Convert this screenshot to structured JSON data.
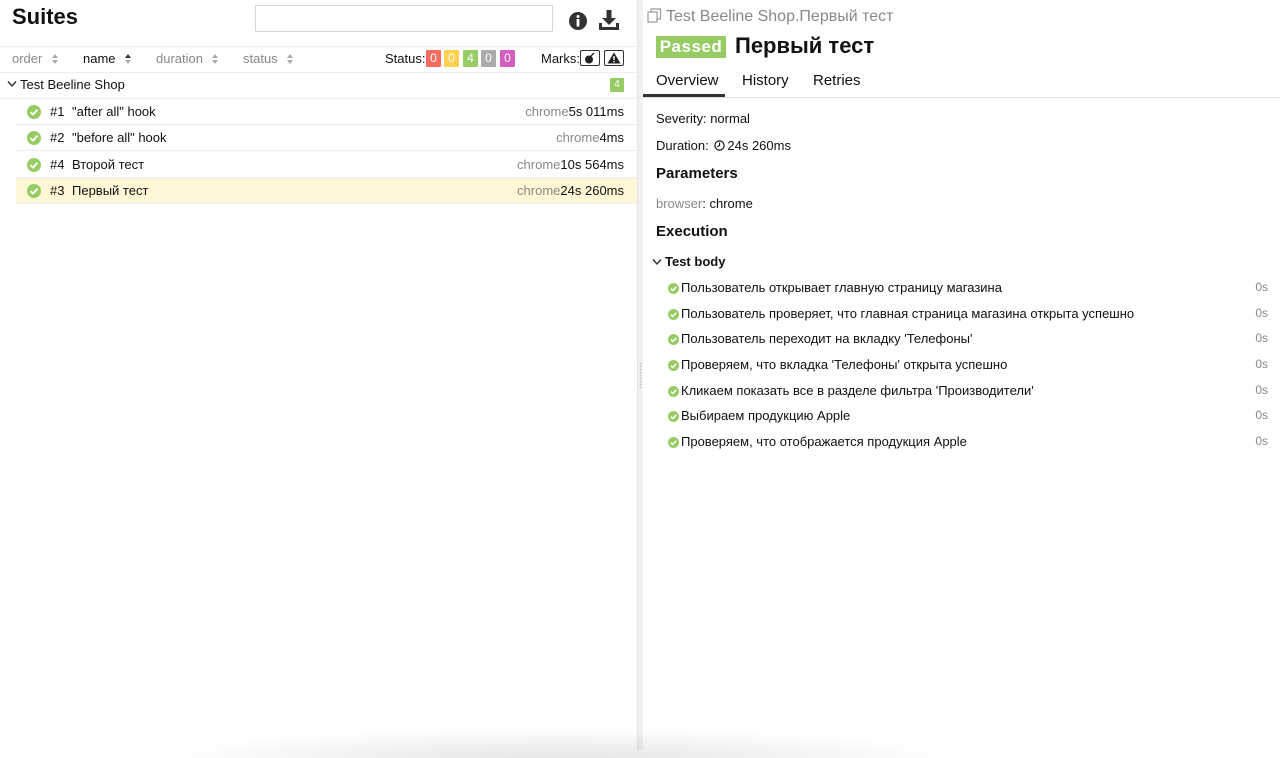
{
  "left": {
    "title": "Suites",
    "search": {
      "value": "",
      "placeholder": ""
    },
    "sort": {
      "order": "order",
      "name": "name",
      "duration": "duration",
      "status": "status"
    },
    "status_filter": {
      "label": "Status:",
      "failed": "0",
      "broken": "0",
      "passed": "4",
      "skipped": "0",
      "unknown": "0"
    },
    "marks_label": "Marks:",
    "group": {
      "name": "Test Beeline Shop",
      "count": "4"
    },
    "tests": [
      {
        "order": "#1",
        "name": "\"after all\" hook",
        "param": "chrome",
        "duration": "5s 011ms"
      },
      {
        "order": "#2",
        "name": "\"before all\" hook",
        "param": "chrome",
        "duration": "4ms"
      },
      {
        "order": "#4",
        "name": "Второй тест",
        "param": "chrome",
        "duration": "10s 564ms"
      },
      {
        "order": "#3",
        "name": "Первый тест",
        "param": "chrome",
        "duration": "24s 260ms"
      }
    ]
  },
  "right": {
    "breadcrumb": "Test Beeline Shop.Первый тест",
    "status": "Passed",
    "title": "Первый тест",
    "tabs": [
      "Overview",
      "History",
      "Retries"
    ],
    "severity": {
      "label": "Severity:",
      "value": "normal"
    },
    "duration": {
      "label": "Duration:",
      "value": "24s 260ms"
    },
    "parameters": {
      "title": "Parameters",
      "name": "browser",
      "sep": ":",
      "value": "chrome"
    },
    "execution": {
      "title": "Execution",
      "body_label": "Test body",
      "steps": [
        {
          "text": "Пользователь открывает главную страницу магазина",
          "duration": "0s"
        },
        {
          "text": "Пользователь проверяет, что главная страница магазина открыта успешно",
          "duration": "0s"
        },
        {
          "text": "Пользователь переходит на вкладку 'Телефоны'",
          "duration": "0s"
        },
        {
          "text": "Проверяем, что вкладка 'Телефоны' открыта успешно",
          "duration": "0s"
        },
        {
          "text": "Кликаем показать все в разделе фильтра 'Производители'",
          "duration": "0s"
        },
        {
          "text": "Выбираем продукцию Apple",
          "duration": "0s"
        },
        {
          "text": "Проверяем, что отображается продукция Apple",
          "duration": "0s"
        }
      ]
    }
  },
  "colors": {
    "passed": "#97cc64",
    "failed": "#f76c5e",
    "broken": "#ffd050",
    "skipped": "#aaaaaa",
    "unknown": "#d35ebe",
    "selected_row": "#fff7d6"
  }
}
